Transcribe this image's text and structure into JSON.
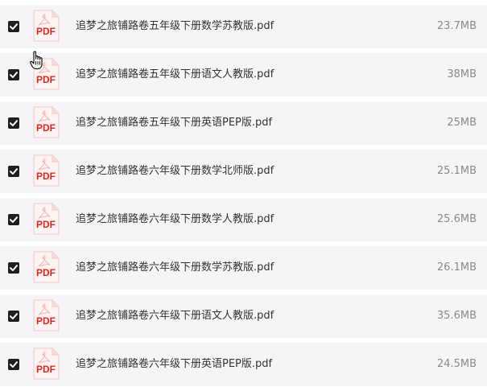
{
  "files": [
    {
      "name": "追梦之旅铺路卷五年级下册数学苏教版.pdf",
      "size": "23.7MB",
      "checked": true,
      "icon_label": "PDF"
    },
    {
      "name": "追梦之旅铺路卷五年级下册语文人教版.pdf",
      "size": "38MB",
      "checked": true,
      "icon_label": "PDF"
    },
    {
      "name": "追梦之旅铺路卷五年级下册英语PEP版.pdf",
      "size": "25MB",
      "checked": true,
      "icon_label": "PDF"
    },
    {
      "name": "追梦之旅铺路卷六年级下册数学北师版.pdf",
      "size": "25.1MB",
      "checked": true,
      "icon_label": "PDF"
    },
    {
      "name": "追梦之旅铺路卷六年级下册数学人教版.pdf",
      "size": "25.6MB",
      "checked": true,
      "icon_label": "PDF"
    },
    {
      "name": "追梦之旅铺路卷六年级下册数学苏教版.pdf",
      "size": "26.1MB",
      "checked": true,
      "icon_label": "PDF"
    },
    {
      "name": "追梦之旅铺路卷六年级下册语文人教版.pdf",
      "size": "35.6MB",
      "checked": true,
      "icon_label": "PDF"
    },
    {
      "name": "追梦之旅铺路卷六年级下册英语PEP版.pdf",
      "size": "24.5MB",
      "checked": true,
      "icon_label": "PDF"
    }
  ],
  "colors": {
    "row_background": "#f5f5f7",
    "pdf_red": "#e2231a",
    "checkbox": "#1f1f1f",
    "name_text": "#333333",
    "size_text": "#8a8a8a"
  },
  "icons": {
    "checkbox": "checkmark-icon",
    "file": "pdf-file-icon",
    "cursor": "hand-pointer-icon"
  }
}
